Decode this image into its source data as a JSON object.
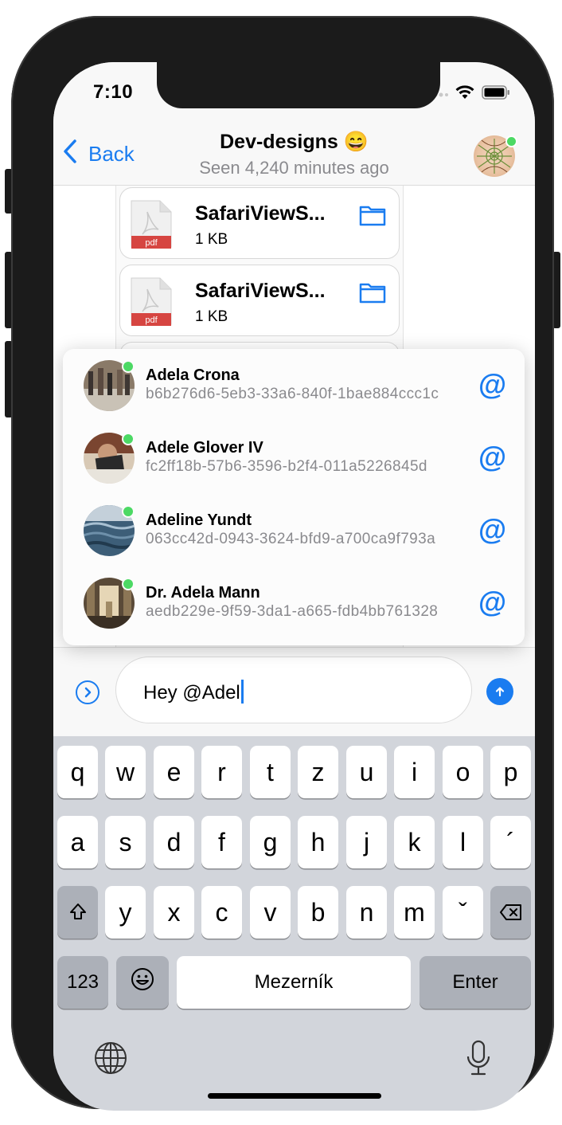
{
  "status_bar": {
    "time": "7:10",
    "signal_icon": "signal-dots-icon",
    "wifi_icon": "wifi-icon",
    "battery_icon": "battery-icon"
  },
  "nav": {
    "back_label": "Back",
    "title": "Dev-designs 😄",
    "subtitle": "Seen 4,240 minutes ago",
    "avatar_icon": "group-avatar"
  },
  "messages": [
    {
      "file_name": "SafariViewS...",
      "file_size": "1 KB",
      "file_type": "pdf",
      "folder_icon": "folder-icon"
    },
    {
      "file_name": "SafariViewS...",
      "file_size": "1 KB",
      "file_type": "pdf",
      "folder_icon": "folder-icon"
    }
  ],
  "mentions": [
    {
      "name": "Adela Crona",
      "id": "b6b276d6-5eb3-33a6-840f-1bae884ccc1c",
      "at": "@"
    },
    {
      "name": "Adele Glover IV",
      "id": "fc2ff18b-57b6-3596-b2f4-011a5226845d",
      "at": "@"
    },
    {
      "name": "Adeline Yundt",
      "id": "063cc42d-0943-3624-bfd9-a700ca9f793a",
      "at": "@"
    },
    {
      "name": "Dr. Adela Mann",
      "id": "aedb229e-9f59-3da1-a665-fdb4bb761328",
      "at": "@"
    }
  ],
  "composer": {
    "text": "Hey @Adel",
    "expand_icon": "chevron-right-circle-icon",
    "send_icon": "arrow-up-circle-icon"
  },
  "keyboard": {
    "row1": [
      "q",
      "w",
      "e",
      "r",
      "t",
      "z",
      "u",
      "i",
      "o",
      "p"
    ],
    "row2": [
      "a",
      "s",
      "d",
      "f",
      "g",
      "h",
      "j",
      "k",
      "l",
      "´"
    ],
    "row3": [
      "y",
      "x",
      "c",
      "v",
      "b",
      "n",
      "m",
      "ˇ"
    ],
    "numbers_label": "123",
    "space_label": "Mezerník",
    "enter_label": "Enter",
    "shift_icon": "shift-icon",
    "delete_icon": "delete-icon",
    "emoji_icon": "emoji-icon",
    "globe_icon": "globe-icon",
    "mic_icon": "microphone-icon"
  },
  "colors": {
    "accent": "#1a7cf0",
    "online": "#4cd964",
    "pdf_red": "#d64541"
  }
}
